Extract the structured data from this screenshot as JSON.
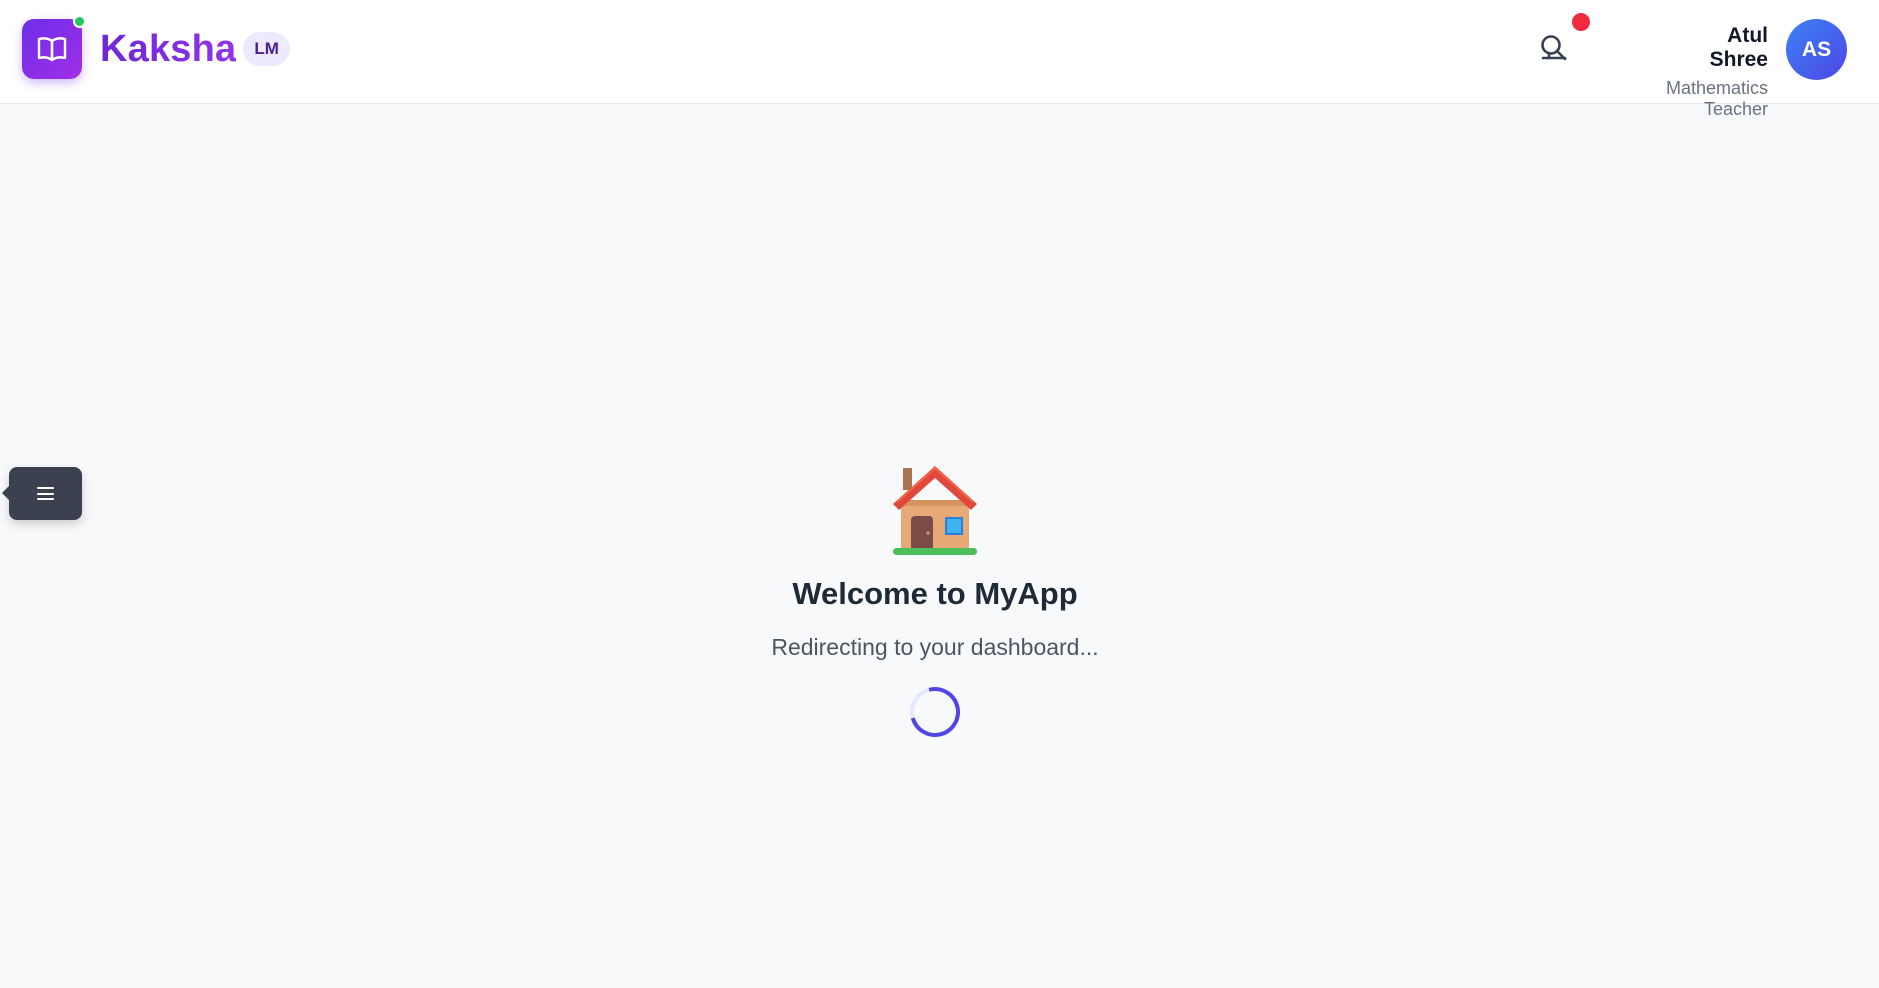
{
  "brand": {
    "name": "Kaksha",
    "badge": "LM",
    "logo_icon": "open-book-icon",
    "status_color": "#22c55e"
  },
  "header": {
    "notification_icon": "bell-icon",
    "notification_dot_color": "#ef2b3d"
  },
  "user": {
    "name": "Atul Shree",
    "role": "Mathematics Teacher",
    "initials": "AS"
  },
  "sidebar": {
    "toggle_icon": "hamburger-menu-icon"
  },
  "main": {
    "icon": "house-icon",
    "title": "Welcome to MyApp",
    "subtitle": "Redirecting to your dashboard...",
    "loader": "spinner"
  },
  "colors": {
    "accent": "#7c3aed",
    "avatar": "#4f46e5",
    "spinner": "#4f46e5"
  }
}
